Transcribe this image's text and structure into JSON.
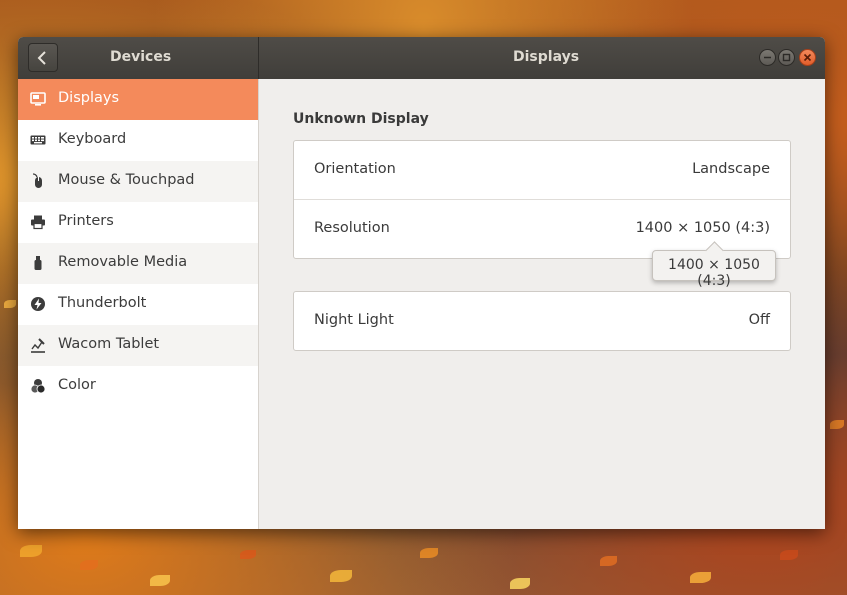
{
  "titlebar": {
    "panel_title": "Devices",
    "main_title": "Displays"
  },
  "sidebar": {
    "items": [
      {
        "label": "Displays",
        "icon": "display-icon",
        "active": true
      },
      {
        "label": "Keyboard",
        "icon": "keyboard-icon"
      },
      {
        "label": "Mouse & Touchpad",
        "icon": "mouse-icon"
      },
      {
        "label": "Printers",
        "icon": "printer-icon"
      },
      {
        "label": "Removable Media",
        "icon": "usb-drive-icon"
      },
      {
        "label": "Thunderbolt",
        "icon": "thunderbolt-icon"
      },
      {
        "label": "Wacom Tablet",
        "icon": "tablet-stylus-icon"
      },
      {
        "label": "Color",
        "icon": "color-icon"
      }
    ]
  },
  "display": {
    "name": "Unknown Display",
    "orientation_label": "Orientation",
    "orientation_value": "Landscape",
    "resolution_label": "Resolution",
    "resolution_value": "1400 × 1050 (4:3)",
    "tooltip": "1400 × 1050 (4:3)",
    "night_light_label": "Night Light",
    "night_light_value": "Off"
  },
  "colors": {
    "accent": "#f48a5b",
    "titlebar": "#45423e",
    "close_button": "#e9683a"
  }
}
